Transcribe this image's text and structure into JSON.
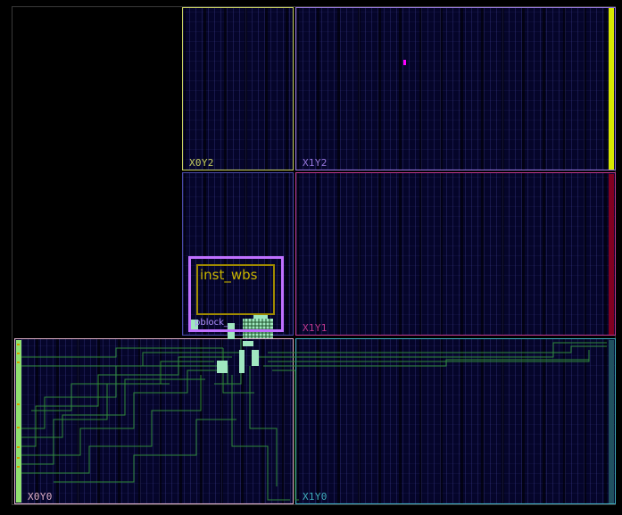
{
  "regions": [
    {
      "id": "X0Y2",
      "label": "X0Y2",
      "color": "#c8d060"
    },
    {
      "id": "X1Y2",
      "label": "X1Y2",
      "color": "#9878e0"
    },
    {
      "id": "X0Y1",
      "label": "",
      "color": "#4848a8"
    },
    {
      "id": "X1Y1",
      "label": "X1Y1",
      "color": "#c03890"
    },
    {
      "id": "X0Y0",
      "label": "X0Y0",
      "color": "#e0b0c8"
    },
    {
      "id": "X1Y0",
      "label": "X1Y0",
      "color": "#40b0c0"
    }
  ],
  "instance": {
    "label": "inst_wbs",
    "color": "#c8b400"
  },
  "pblock": {
    "label": "pblock_",
    "color": "#c070ff"
  },
  "colors": {
    "background": "#000000",
    "routing": "#2f8a3a",
    "cells": "#a0e8c0",
    "io_bank": "#90e070",
    "clock_bar": "#d8e800",
    "right_bar_mid": "#800020",
    "right_bar_bottom": "#205060",
    "marker": "#ff00ff"
  }
}
